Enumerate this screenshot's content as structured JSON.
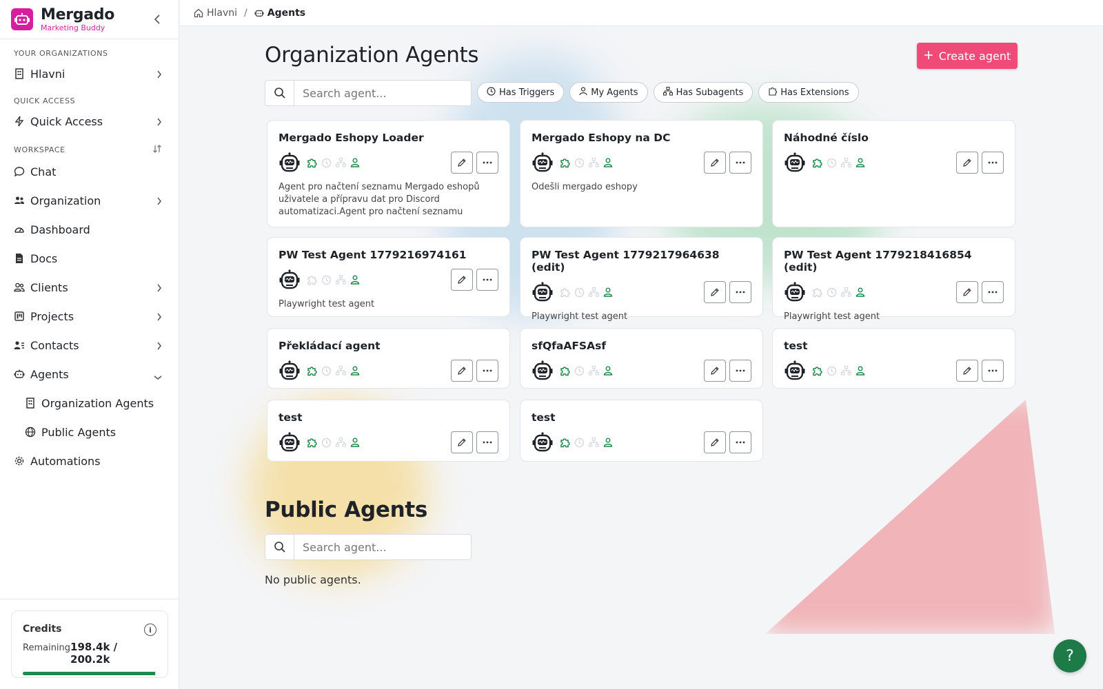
{
  "brand": {
    "name": "Mergado",
    "subtitle": "Marketing Buddy"
  },
  "sidebar": {
    "sections": {
      "orgs": "YOUR ORGANIZATIONS",
      "quick": "QUICK ACCESS",
      "workspace": "WORKSPACE"
    },
    "org_item": "Hlavni",
    "quick_item": "Quick Access",
    "workspace_items": {
      "chat": "Chat",
      "organization": "Organization",
      "dashboard": "Dashboard",
      "docs": "Docs",
      "clients": "Clients",
      "projects": "Projects",
      "contacts": "Contacts",
      "agents": "Agents",
      "org_agents": "Organization Agents",
      "public_agents": "Public Agents",
      "automations": "Automations"
    }
  },
  "credits": {
    "title": "Credits",
    "remaining_label": "Remaining",
    "value": "198.4k / 200.2k",
    "fraction": 0.991
  },
  "breadcrumb": {
    "home": "Hlavni",
    "separator": "/",
    "current": "Agents"
  },
  "main": {
    "title": "Organization Agents",
    "create_label": "Create agent",
    "search_placeholder": "Search agent...",
    "filters": {
      "triggers": "Has Triggers",
      "mine": "My Agents",
      "subagents": "Has Subagents",
      "extensions": "Has Extensions"
    },
    "agents": [
      {
        "name": "Mergado Eshopy Loader",
        "desc": "Agent pro načtení seznamu Mergado eshopů uživatele a přípravu dat pro Discord automatizaci.Agent pro načtení seznamu Mergado eshopů uživatele a přípravu dat pro Discord automatizaci."
      },
      {
        "name": "Mergado Eshopy na DC",
        "desc": "Odešli mergado eshopy"
      },
      {
        "name": "Náhodné číslo",
        "desc": ""
      },
      {
        "name": "PW Test Agent 1779216974161",
        "desc": "Playwright test agent"
      },
      {
        "name": "PW Test Agent 1779217964638 (edit)",
        "desc": "Playwright test agent"
      },
      {
        "name": "PW Test Agent 1779218416854 (edit)",
        "desc": "Playwright test agent"
      },
      {
        "name": "Překládací agent",
        "desc": ""
      },
      {
        "name": "sfQfaAFSAsf",
        "desc": ""
      },
      {
        "name": "test",
        "desc": ""
      },
      {
        "name": "test",
        "desc": ""
      },
      {
        "name": "test",
        "desc": ""
      }
    ],
    "public_title": "Public Agents",
    "public_search_placeholder": "Search agent...",
    "no_public": "No public agents."
  },
  "help_label": "?",
  "colors": {
    "accent": "#ef4a78",
    "brand": "#d61f9e",
    "success": "#1e8a4c"
  }
}
